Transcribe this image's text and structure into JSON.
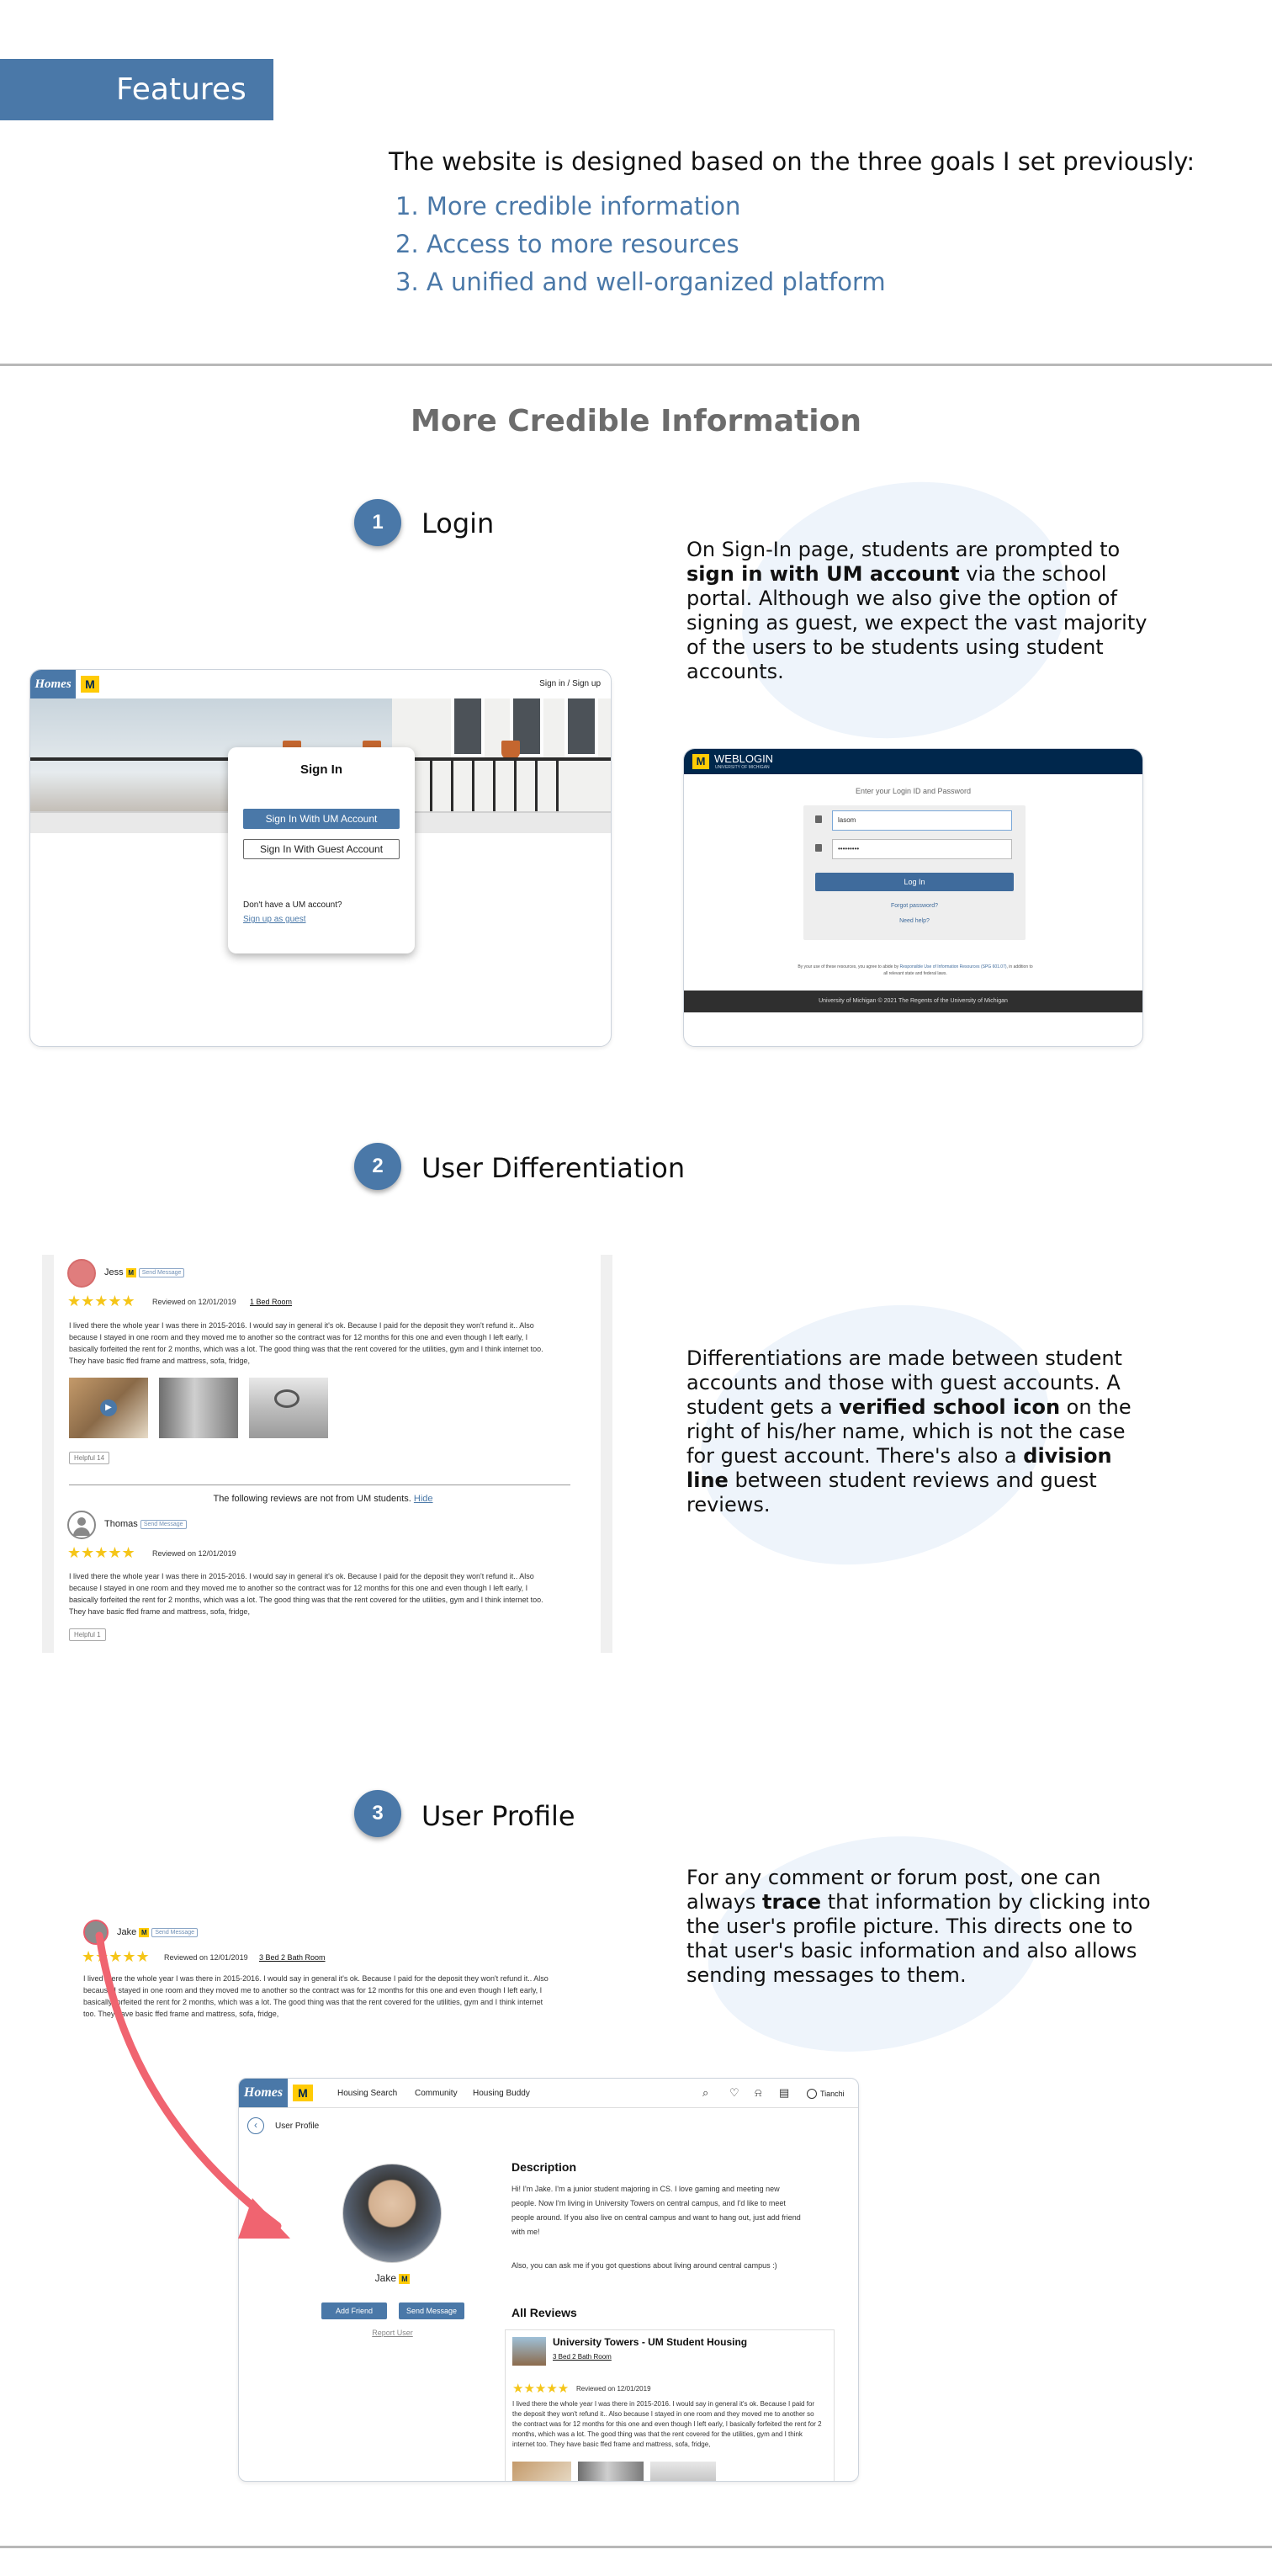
{
  "header": {
    "features_label": "Features"
  },
  "intro": {
    "text": "The website is designed based on the three goals I set previously:",
    "goals": [
      "1. More credible information",
      "2. Access to more resources",
      "3. A unified and well-organized platform"
    ]
  },
  "section": {
    "title": "More Credible Information"
  },
  "steps": [
    {
      "number": "1",
      "title": "Login",
      "desc_parts": [
        "On Sign-In page, students are prompted to ",
        "sign in with UM account",
        " via the school portal. Although we also give the option of signing as guest, we expect the vast majority of the users to be students using student accounts."
      ]
    },
    {
      "number": "2",
      "title": "User Differentiation",
      "desc_parts": [
        "Differentiations are made between student accounts and those with guest accounts. A student gets a ",
        "verified school icon",
        " on the right of his/her name, which is not the case for guest account. There's also a ",
        "division line",
        " between student reviews and guest reviews."
      ]
    },
    {
      "number": "3",
      "title": "User Profile",
      "desc_parts": [
        "For any comment or forum post, one can always ",
        "trace",
        " that information by clicking into the user's profile picture. This directs one to that user's basic information and also allows sending messages to them."
      ]
    }
  ],
  "signin_mock": {
    "logo": "Homes",
    "m_logo": "M",
    "top_link": "Sign in / Sign up",
    "modal_title": "Sign In",
    "um_button": "Sign In With UM Account",
    "guest_button": "Sign In With Guest Account",
    "no_account": "Don't have a UM account?",
    "guest_link": "Sign up as guest"
  },
  "weblogin_mock": {
    "m_logo": "M",
    "title": "WEBLOGIN",
    "subtitle": "UNIVERSITY OF MICHIGAN",
    "prompt": "Enter your Login ID and Password",
    "username_value": "lasom",
    "password_value": "•••••••••",
    "login_button": "Log In",
    "forgot_link": "Forgot password?",
    "help_link": "Need help?",
    "policy_text_1": "By your use of these resources, you agree to abide by ",
    "policy_link": "Responsible Use of Information Resources (SPG 601.07)",
    "policy_text_2": ", in addition to all relevant state and federal laws.",
    "footer": "University of Michigan   © 2021 The Regents of the University of Michigan"
  },
  "reviews_mock": {
    "review1": {
      "name": "Jess",
      "badge": "M",
      "send": "Send Message",
      "stars": "★★★★★",
      "reviewed": "Reviewed on 12/01/2019",
      "room": "1 Bed Room",
      "text": "I lived there the whole year I was there in 2015-2016. I would say in general it's ok. Because I paid for the deposit they won't refund it.. Also because I stayed in one room and they moved me to another so the contract was for 12 months for this one and even though I left early, I basically forfeited the rent for 2 months, which was a lot. The good thing was that the rent covered for the utilities, gym and I think internet too. They have basic ffed frame and mattress, sofa, fridge,",
      "helpful": "Helpful 14"
    },
    "divider_text": "The following reviews are not from UM students.",
    "hide_link": "Hide",
    "review2": {
      "name": "Thomas",
      "send": "Send Message",
      "stars": "★★★★★",
      "reviewed": "Reviewed on 12/01/2019",
      "text": "I lived there the whole year I was there in 2015-2016. I would say in general it's ok. Because I paid for the deposit they won't refund it.. Also because I stayed in one room and they moved me to another so the contract was for 12 months for this one and even though I left early, I basically forfeited the rent for 2 months, which was a lot. The good thing was that the rent covered for the utilities, gym and I think internet too. They have basic ffed frame and mattress, sofa, fridge,",
      "helpful": "Helpful 1"
    }
  },
  "profile_review": {
    "name": "Jake",
    "badge": "M",
    "send": "Send Message",
    "stars": "★★★★★",
    "reviewed": "Reviewed on 12/01/2019",
    "room": "3 Bed 2 Bath Room",
    "text": "I lived there the whole year I was there in 2015-2016. I would say in general it's ok. Because I paid for the deposit they won't refund it.. Also because I stayed in one room and they moved me to another so the contract was for 12 months for this one and even though I left early, I basically forfeited the rent for 2 months, which was a lot. The good thing was that the rent covered for the utilities, gym and I think internet too. They have basic ffed frame and mattress, sofa, fridge,"
  },
  "profile_page": {
    "logo": "Homes",
    "m_logo": "M",
    "nav": [
      "Housing Search",
      "Community",
      "Housing Buddy"
    ],
    "user": "Tianchi",
    "back_title": "User Profile",
    "name": "Jake",
    "badge": "M",
    "add_friend": "Add Friend",
    "send_message": "Send Message",
    "report": "Report User",
    "description_title": "Description",
    "description_1": "Hi! I'm Jake. I'm a junior student majoring in CS. I love gaming and meeting new people. Now I'm living in University Towers on central campus, and I'd like to meet people around. If you also live on central campus and want to hang out, just add friend with me!",
    "description_2": "Also, you can ask me if you got questions about living around central campus :)",
    "all_reviews": "All Reviews",
    "review_property": "University Towers - UM Student Housing",
    "review_room": "3 Bed 2 Bath Room",
    "review_stars": "★★★★★",
    "review_date": "Reviewed on 12/01/2019",
    "review_text": "I lived there the whole year I was there in 2015-2016. I would say in general it's ok. Because I paid for the deposit they won't refund it.. Also because I stayed in one room and they moved me to another so the contract was for 12 months for this one and even though I left early, I basically forfeited the rent for 2 months, which was a lot. The good thing was that the rent covered for the utilities, gym and I think internet too. They have basic ffed frame and mattress, sofa, fridge,"
  },
  "colors": {
    "accent": "#4a78a8",
    "um_maize": "#ffcb05",
    "um_blue": "#00274c",
    "arrow": "#f06470",
    "star": "#f5c518"
  }
}
